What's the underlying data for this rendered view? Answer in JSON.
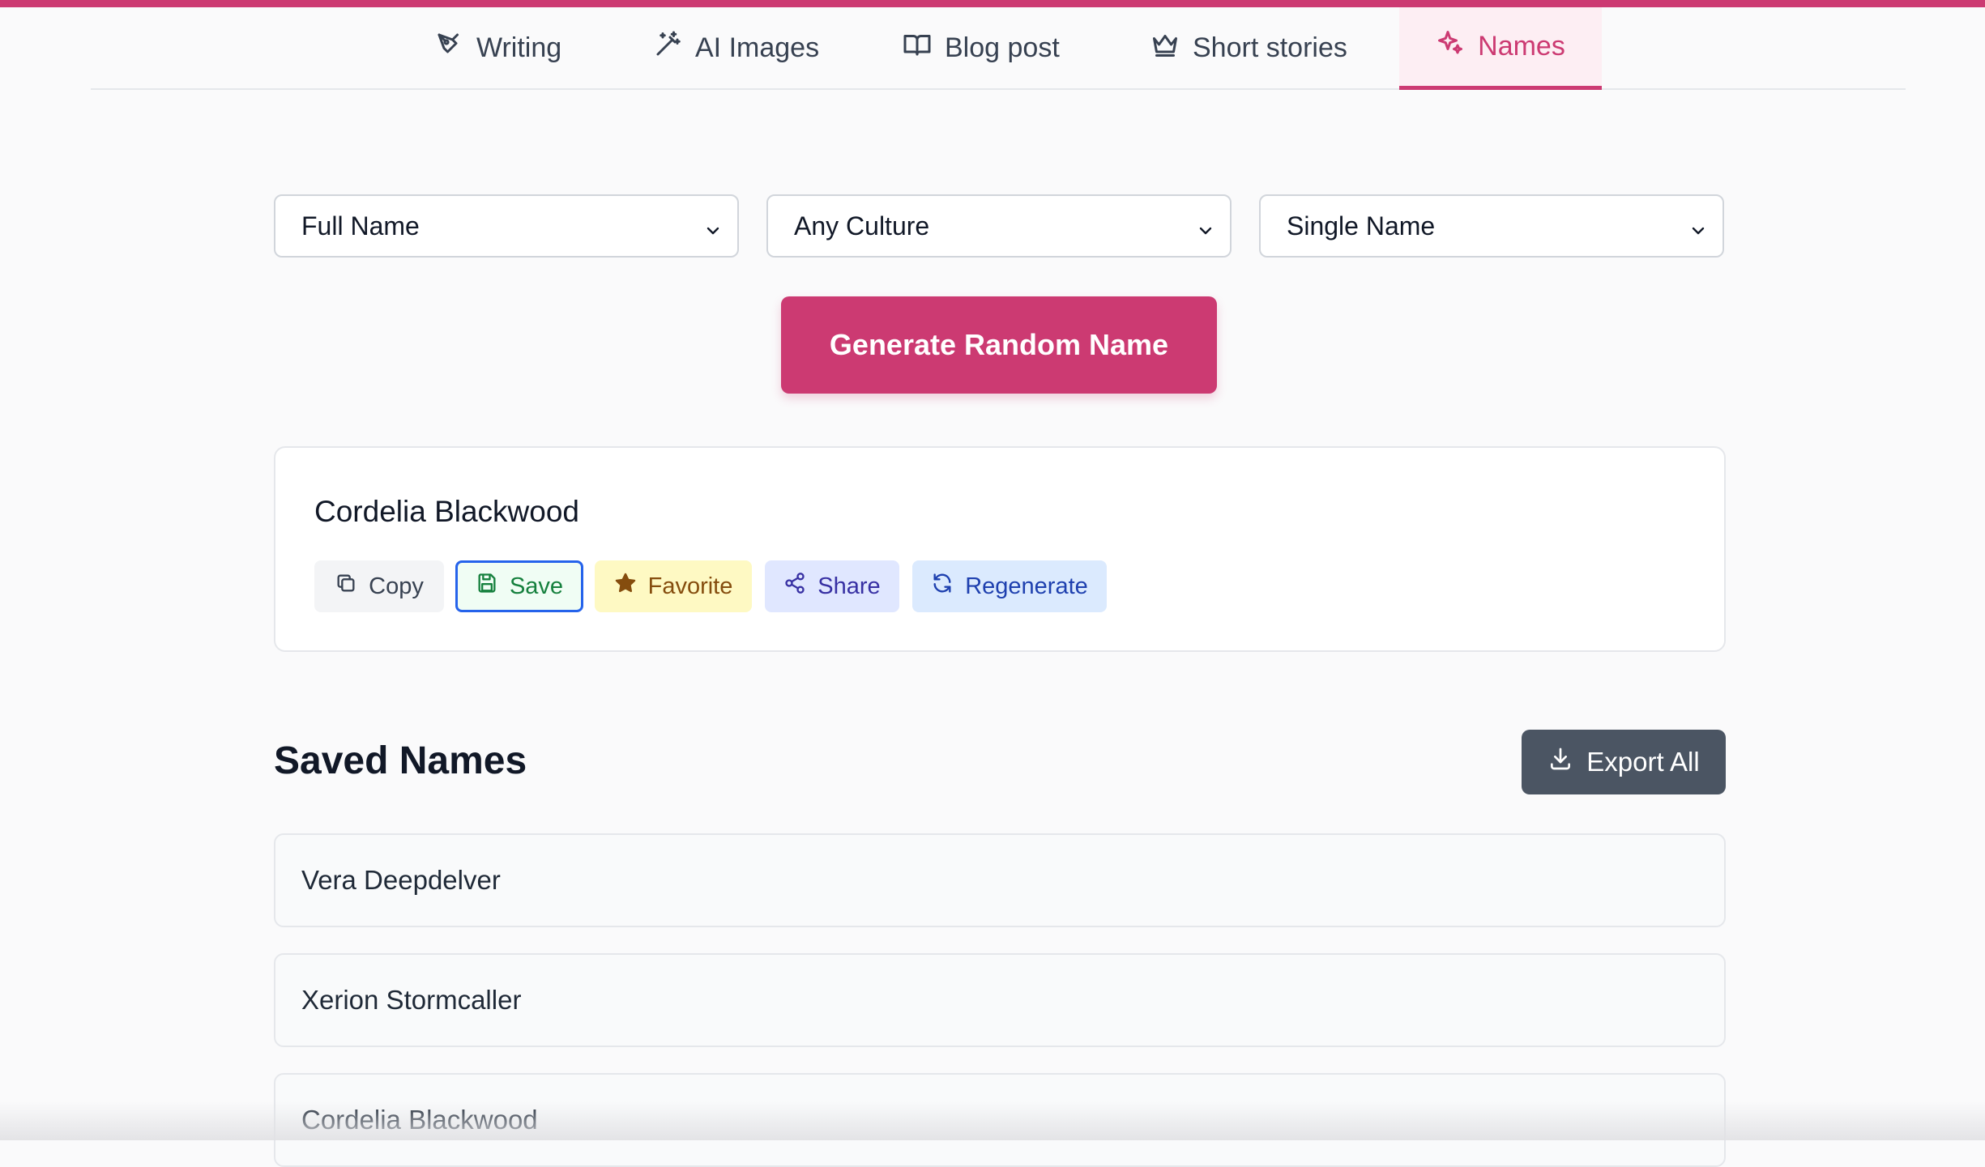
{
  "tabs": [
    {
      "label": "Writing",
      "icon": "pen-nib-icon"
    },
    {
      "label": "AI Images",
      "icon": "magic-wand-icon"
    },
    {
      "label": "Blog post",
      "icon": "open-book-icon"
    },
    {
      "label": "Short stories",
      "icon": "crown-icon"
    },
    {
      "label": "Names",
      "icon": "sparkles-icon",
      "active": true
    }
  ],
  "filters": {
    "name_type": "Full Name",
    "culture": "Any Culture",
    "format": "Single Name"
  },
  "generate_label": "Generate Random Name",
  "result": {
    "name": "Cordelia Blackwood",
    "actions": {
      "copy": "Copy",
      "save": "Save",
      "favorite": "Favorite",
      "share": "Share",
      "regenerate": "Regenerate"
    }
  },
  "saved": {
    "title": "Saved Names",
    "export_label": "Export All",
    "items": [
      "Vera Deepdelver",
      "Xerion Stormcaller",
      "Cordelia Blackwood"
    ]
  },
  "colors": {
    "accent": "#cc3a72",
    "export_bg": "#4b5563"
  }
}
